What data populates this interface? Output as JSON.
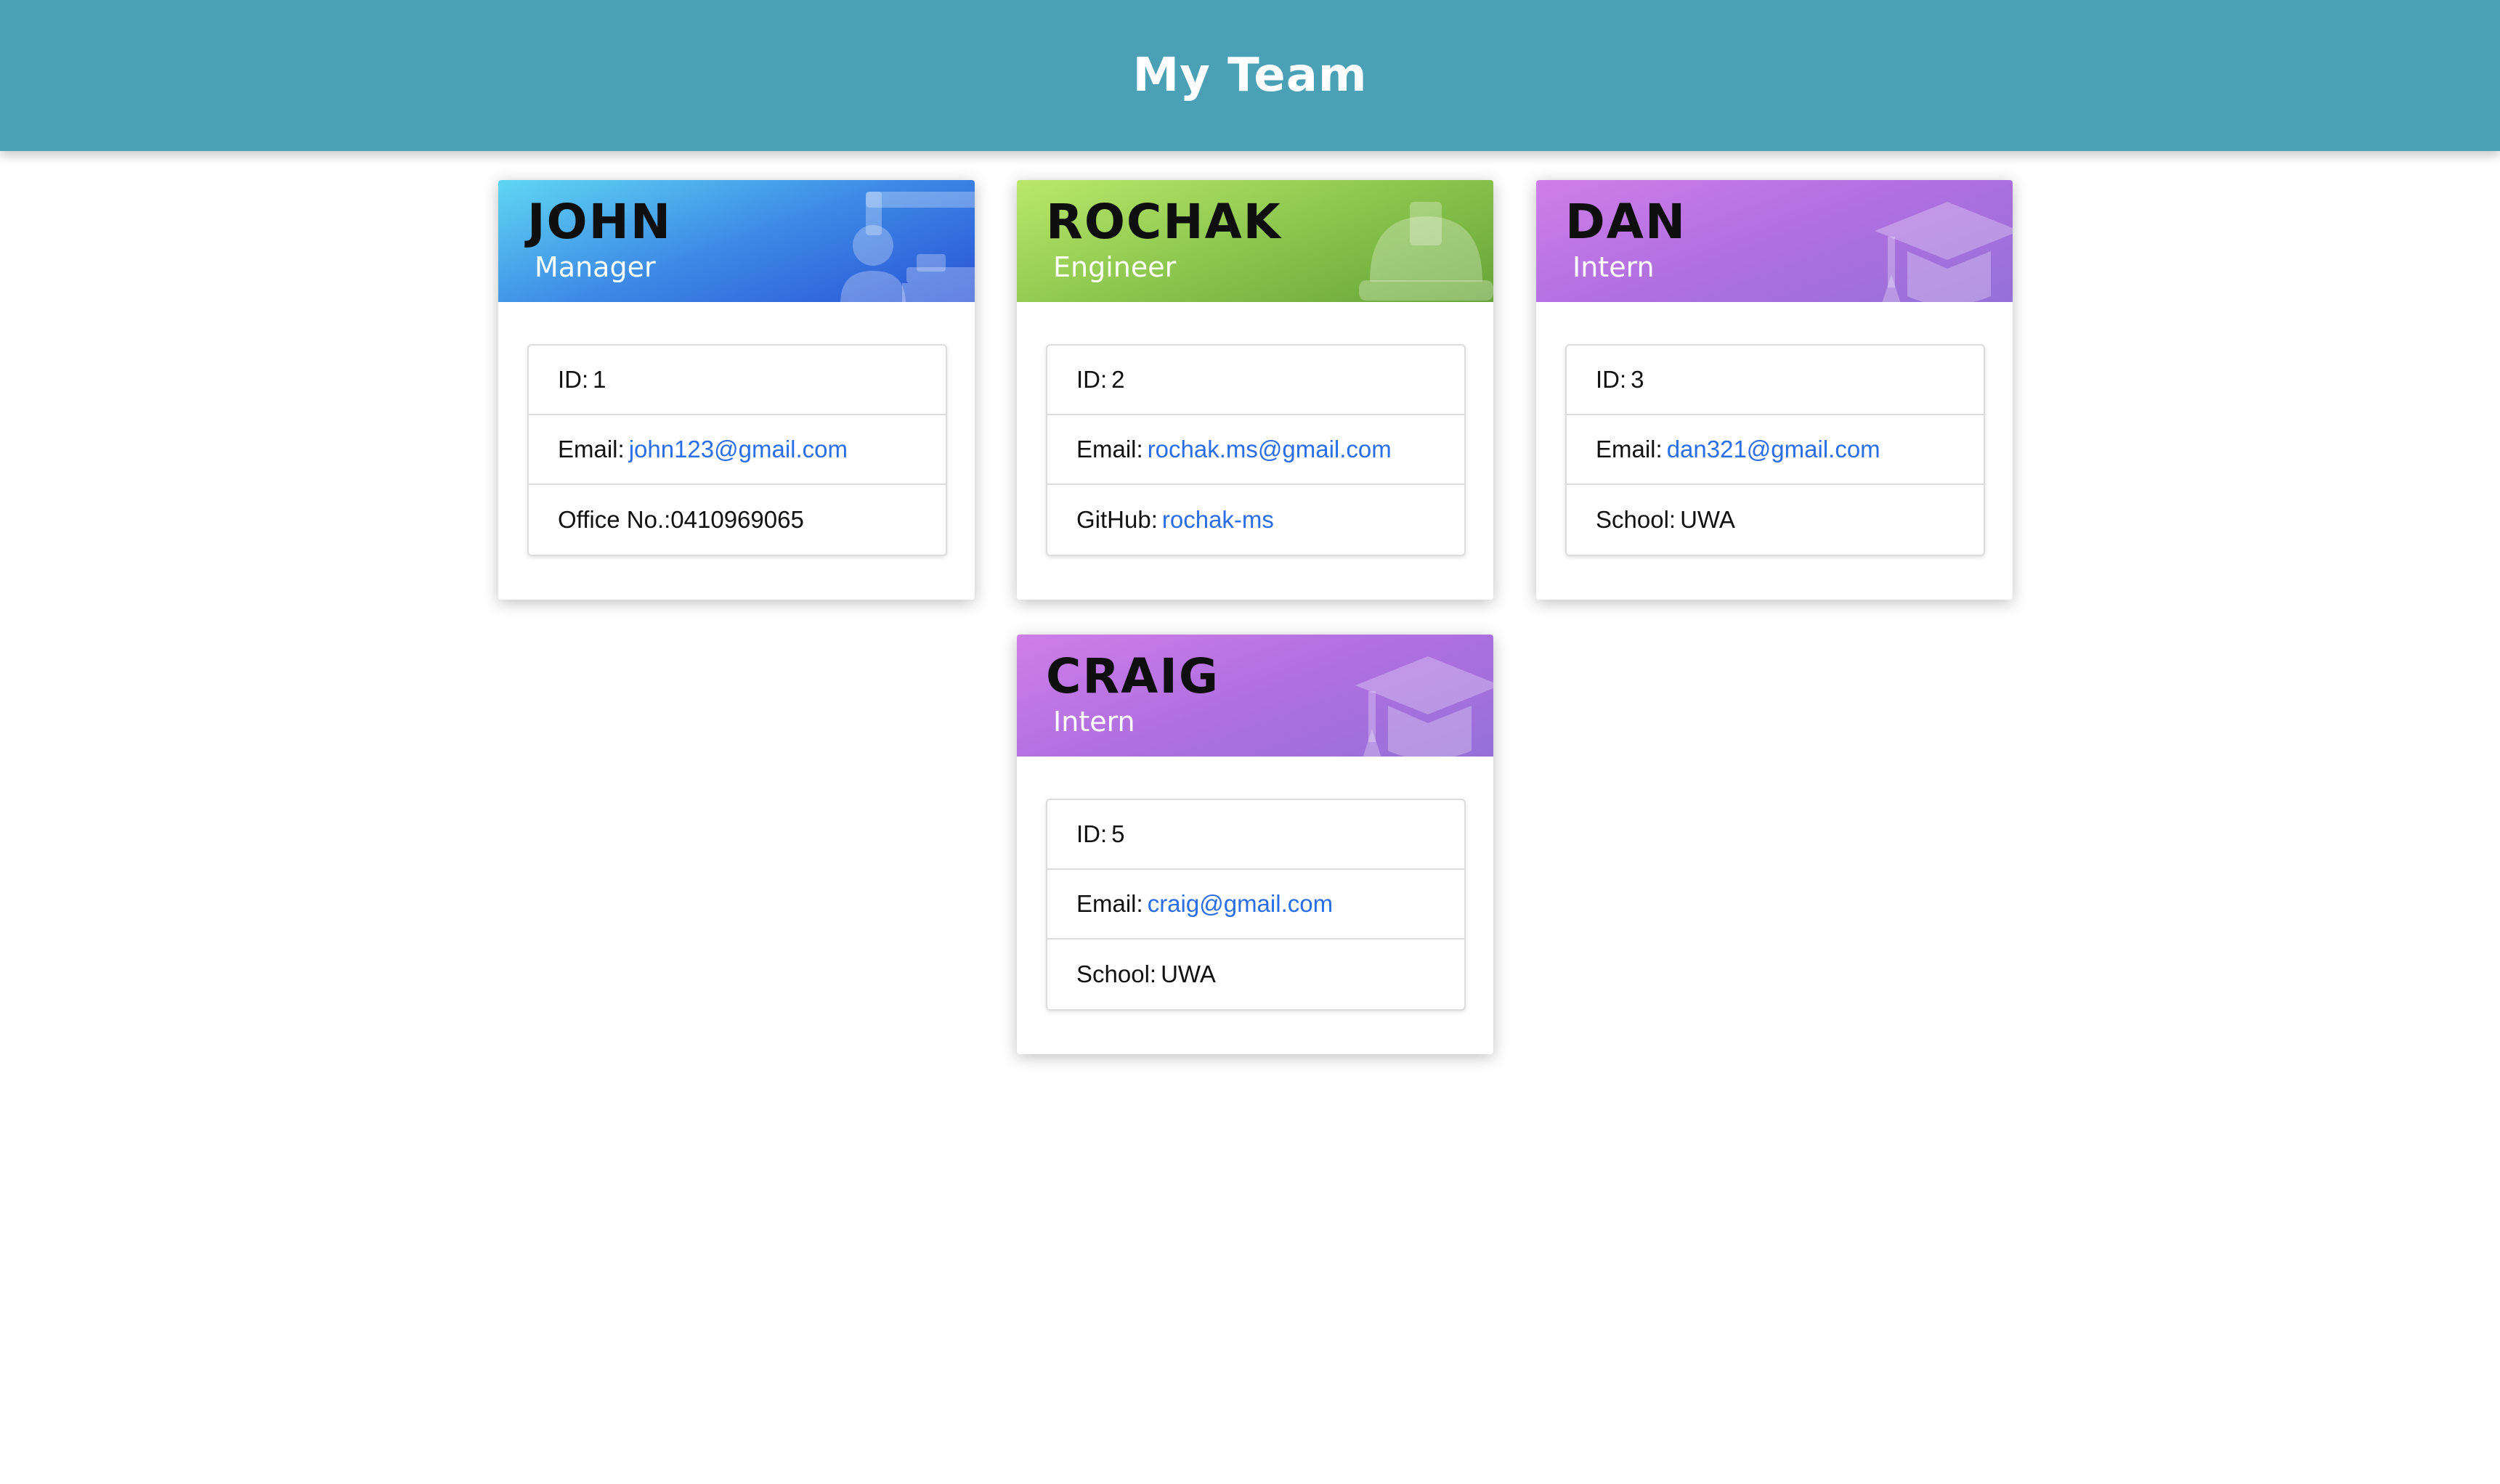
{
  "header": {
    "title": "My Team"
  },
  "team": [
    {
      "name": "JOHN",
      "role": "Manager",
      "icon": "manager-icon",
      "id_label": "ID:",
      "id": "1",
      "email_label": "Email:",
      "email": "john123@gmail.com",
      "extra_label": "Office No.:",
      "extra_value": "0410969065"
    },
    {
      "name": "ROCHAK",
      "role": "Engineer",
      "icon": "hard-hat-icon",
      "id_label": "ID:",
      "id": "2",
      "email_label": "Email:",
      "email": "rochak.ms@gmail.com",
      "extra_label": "GitHub:",
      "extra_value": "rochak-ms"
    },
    {
      "name": "DAN",
      "role": "Intern",
      "icon": "graduation-cap-icon",
      "id_label": "ID:",
      "id": "3",
      "email_label": "Email:",
      "email": "dan321@gmail.com",
      "extra_label": "School:",
      "extra_value": "UWA"
    },
    {
      "name": "CRAIG",
      "role": "Intern",
      "icon": "graduation-cap-icon",
      "id_label": "ID:",
      "id": "5",
      "email_label": "Email:",
      "email": "craig@gmail.com",
      "extra_label": "School:",
      "extra_value": "UWA"
    }
  ]
}
